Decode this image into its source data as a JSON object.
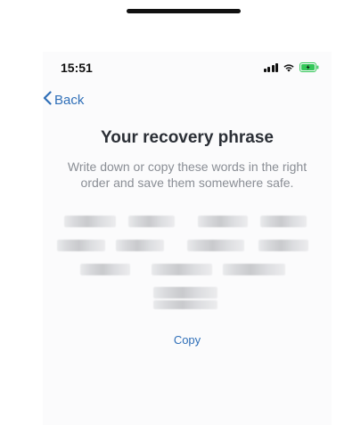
{
  "status_bar": {
    "time": "15:51",
    "signal_icon": "cellular-signal-icon",
    "wifi_icon": "wifi-icon",
    "battery_icon": "battery-charging-icon"
  },
  "nav": {
    "back_label": "Back",
    "back_icon": "chevron-left-icon"
  },
  "main": {
    "title": "Your recovery phrase",
    "subtitle": "Write down or copy these words in the right order and save them somewhere safe.",
    "copy_label": "Copy"
  },
  "colors": {
    "accent": "#2f6fb8",
    "title": "#2b2f36",
    "subtitle": "#8a8e95",
    "battery_green": "#34c759"
  }
}
